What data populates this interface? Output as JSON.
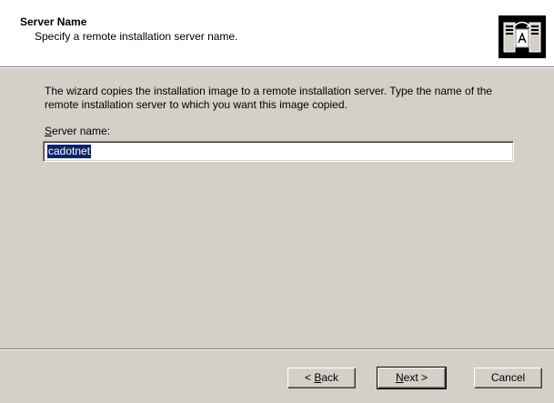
{
  "header": {
    "title": "Server Name",
    "subtitle": "Specify a remote installation server name.",
    "icon": "server-copy-icon"
  },
  "main": {
    "description": "The wizard copies the installation image to a remote installation server. Type the name of the remote installation server to which you want this image copied.",
    "server_name_label_accel": "S",
    "server_name_label_rest": "erver name:",
    "server_name_value": "cadotnet"
  },
  "buttons": {
    "back_prefix": "< ",
    "back_accel": "B",
    "back_rest": "ack",
    "next_accel": "N",
    "next_rest": "ext >",
    "cancel": "Cancel"
  },
  "colors": {
    "dialog_bg": "#d4d0c8",
    "header_bg": "#ffffff",
    "selection_bg": "#0a246a"
  }
}
